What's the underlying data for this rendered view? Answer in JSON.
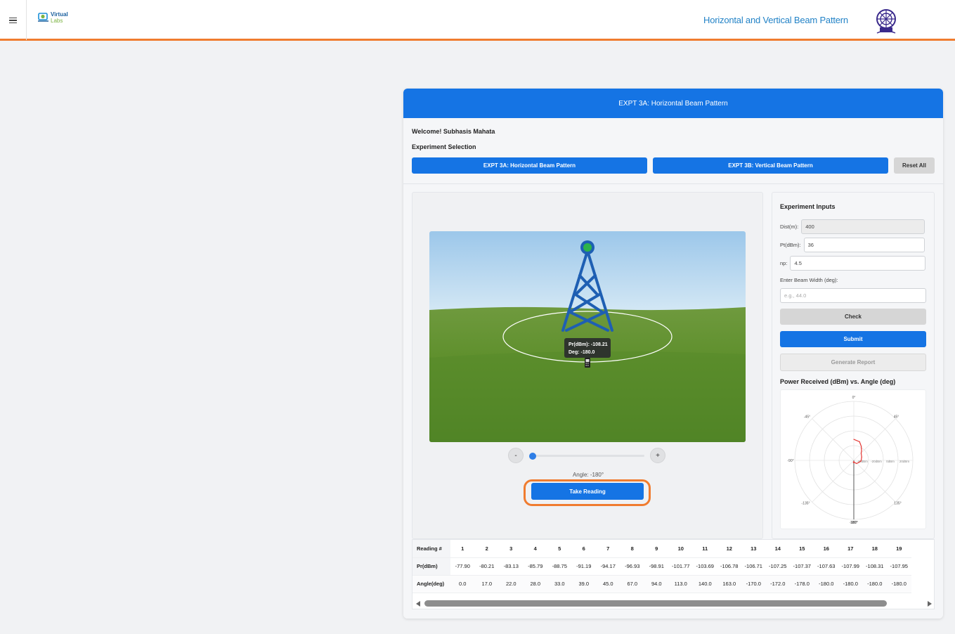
{
  "header": {
    "menu_icon": "hamburger-menu-icon",
    "logo_line1": "Virtual",
    "logo_line2": "Labs",
    "title": "Horizontal and Vertical Beam Pattern",
    "emblem_icon": "institute-emblem-icon",
    "accent_color": "#f07c2f"
  },
  "card": {
    "header_title": "EXPT 3A: Horizontal Beam Pattern",
    "welcome": "Welcome! Subhasis Mahata",
    "experiment_selection_label": "Experiment Selection",
    "btn_exp_a": "EXPT 3A: Horizontal Beam Pattern",
    "btn_exp_b": "EXPT 3B: Vertical Beam Pattern",
    "btn_reset": "Reset All",
    "primary_color": "#1574e4"
  },
  "simulation": {
    "tooltip_pr": "Pr(dBm): -108.21",
    "tooltip_deg": "Deg: -180.0",
    "minus_label": "-",
    "plus_label": "+",
    "slider_fraction": 0.0,
    "angle_label": "Angle: -180°",
    "take_reading_label": "Take Reading",
    "tower_icon": "antenna-tower-icon",
    "receiver_icon": "mobile-receiver-icon"
  },
  "inputs": {
    "title": "Experiment Inputs",
    "dist_label": "Dist(m):",
    "dist_value": "400",
    "pt_label": "Pt(dBm):",
    "pt_value": "36",
    "np_label": "np:",
    "np_value": "4.5",
    "beam_label": "Enter Beam Width (deg):",
    "beam_placeholder": "e.g., 44.0",
    "check_label": "Check",
    "submit_label": "Submit",
    "report_label": "Generate Report",
    "chart_title": "Power Received (dBm) vs. Angle (deg)"
  },
  "chart_data": {
    "type": "polar-line",
    "title": "Power Received (dBm) vs. Angle (deg)",
    "angular_ticks": [
      "0°",
      "45°",
      "-45°",
      "-90°",
      "-135°",
      "135°",
      "-180°",
      "180°"
    ],
    "radial_ticks": [
      "-40dBm",
      "-20dBm",
      "0dBm",
      "20dBm"
    ],
    "series": [
      {
        "color": "#e53935",
        "angles": [
          0.0,
          17.0,
          22.0,
          28.0,
          33.0,
          39.0,
          45.0,
          67.0,
          94.0,
          113.0,
          140.0,
          163.0,
          -170.0,
          -172.0,
          -178.0,
          -180.0,
          -180.0,
          -180.0,
          -180.0
        ],
        "values": [
          -77.9,
          -80.21,
          -83.13,
          -85.79,
          -88.75,
          -91.19,
          -94.17,
          -96.93,
          -98.91,
          -101.77,
          -103.69,
          -106.78,
          -106.71,
          -107.25,
          -107.37,
          -107.63,
          -107.99,
          -108.31,
          -108.21
        ]
      }
    ]
  },
  "readings": {
    "header_label": "Reading #",
    "pr_label": "Pr(dBm)",
    "angle_label": "Angle(deg)",
    "numbers": [
      "1",
      "2",
      "3",
      "4",
      "5",
      "6",
      "7",
      "8",
      "9",
      "10",
      "11",
      "12",
      "13",
      "14",
      "15",
      "16",
      "17",
      "18",
      "19"
    ],
    "pr": [
      "-77.90",
      "-80.21",
      "-83.13",
      "-85.79",
      "-88.75",
      "-91.19",
      "-94.17",
      "-96.93",
      "-98.91",
      "-101.77",
      "-103.69",
      "-106.78",
      "-106.71",
      "-107.25",
      "-107.37",
      "-107.63",
      "-107.99",
      "-108.31",
      "-107.95"
    ],
    "angle": [
      "0.0",
      "17.0",
      "22.0",
      "28.0",
      "33.0",
      "39.0",
      "45.0",
      "67.0",
      "94.0",
      "113.0",
      "140.0",
      "163.0",
      "-170.0",
      "-172.0",
      "-178.0",
      "-180.0",
      "-180.0",
      "-180.0",
      "-180.0"
    ]
  }
}
